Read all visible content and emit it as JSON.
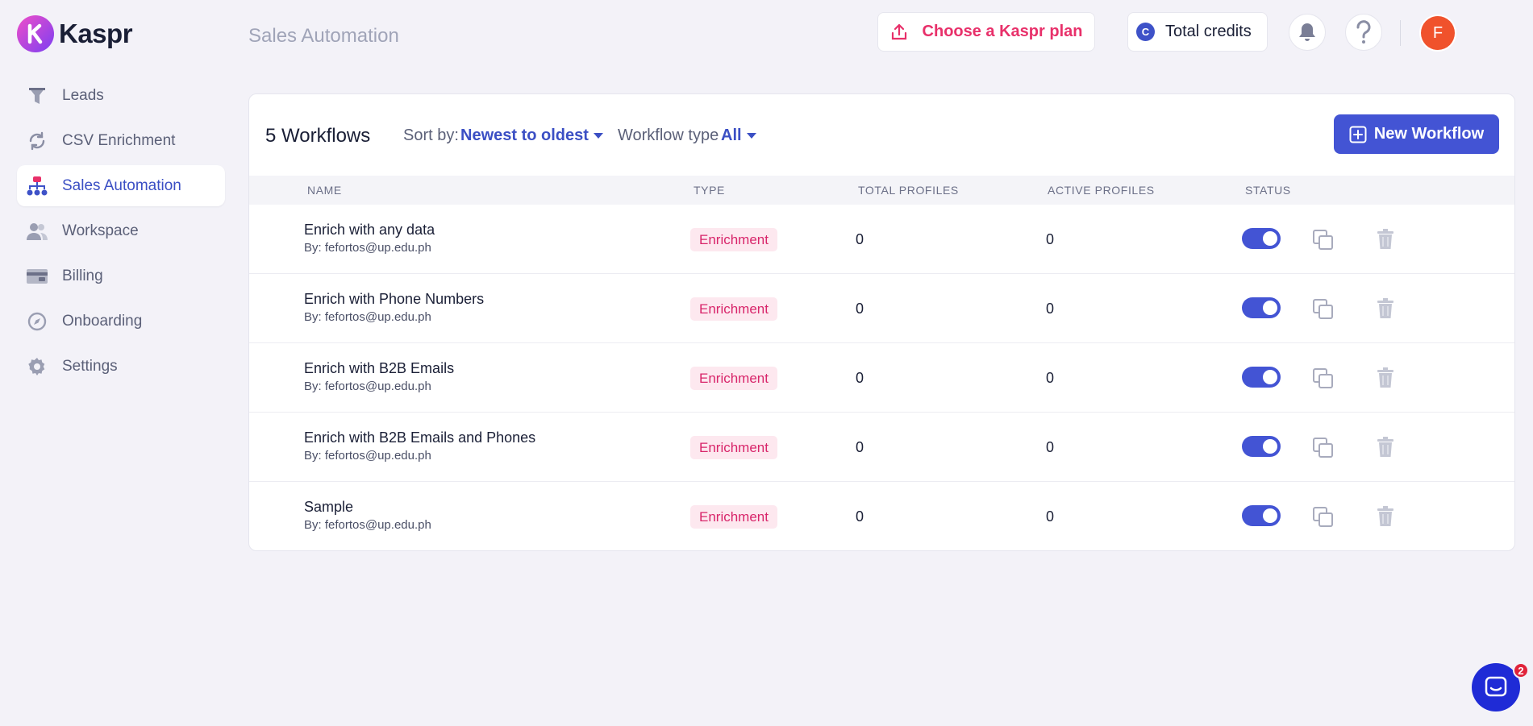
{
  "brand": {
    "name": "Kaspr",
    "logo_icon": "kaspr-k-logo",
    "accent": "#4354d4",
    "pink": "#e8306a"
  },
  "sidebar": {
    "items": [
      {
        "label": "Leads",
        "icon": "funnel-icon",
        "active": false
      },
      {
        "label": "CSV Enrichment",
        "icon": "refresh-icon",
        "active": false
      },
      {
        "label": "Sales Automation",
        "icon": "org-chart-icon",
        "active": true
      },
      {
        "label": "Workspace",
        "icon": "users-icon",
        "active": false
      },
      {
        "label": "Billing",
        "icon": "credit-card-icon",
        "active": false
      },
      {
        "label": "Onboarding",
        "icon": "compass-icon",
        "active": false
      },
      {
        "label": "Settings",
        "icon": "gear-icon",
        "active": false
      }
    ]
  },
  "header": {
    "title": "Sales Automation",
    "plan_button": "Choose a Kaspr plan",
    "credits_badge": "C",
    "credits_label": "Total credits",
    "avatar_initial": "F"
  },
  "toolbar": {
    "count": "5 Workflows",
    "sort_label": "Sort by:",
    "sort_value": "Newest to oldest",
    "type_label": "Workflow type",
    "type_value": "All",
    "new_button": "New Workflow"
  },
  "table": {
    "columns": [
      "NAME",
      "TYPE",
      "TOTAL PROFILES",
      "ACTIVE PROFILES",
      "STATUS"
    ],
    "rows": [
      {
        "name": "Enrich with any data",
        "by": "By: fefortos@up.edu.ph",
        "type": "Enrichment",
        "total": "0",
        "active": "0",
        "status": true
      },
      {
        "name": "Enrich with Phone Numbers",
        "by": "By: fefortos@up.edu.ph",
        "type": "Enrichment",
        "total": "0",
        "active": "0",
        "status": true
      },
      {
        "name": "Enrich with B2B Emails",
        "by": "By: fefortos@up.edu.ph",
        "type": "Enrichment",
        "total": "0",
        "active": "0",
        "status": true
      },
      {
        "name": "Enrich with B2B Emails and Phones",
        "by": "By: fefortos@up.edu.ph",
        "type": "Enrichment",
        "total": "0",
        "active": "0",
        "status": true
      },
      {
        "name": "Sample",
        "by": "By: fefortos@up.edu.ph",
        "type": "Enrichment",
        "total": "0",
        "active": "0",
        "status": true
      }
    ]
  },
  "chat": {
    "unread": "2"
  }
}
